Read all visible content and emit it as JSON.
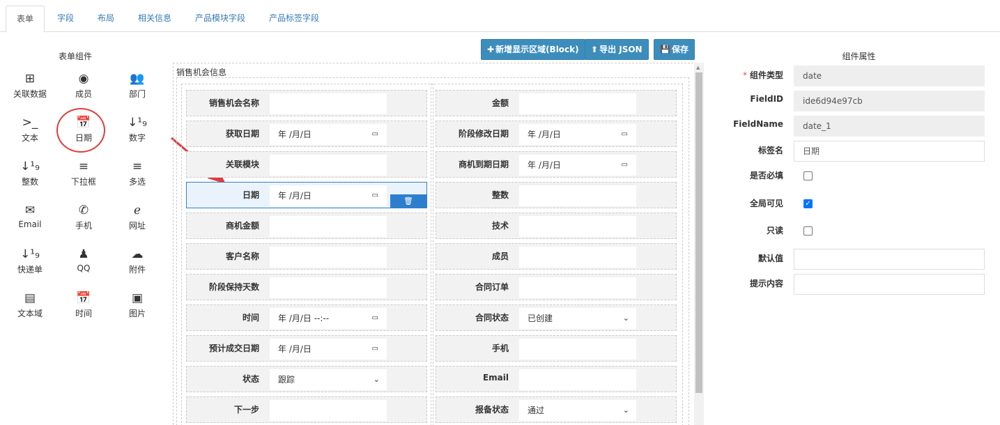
{
  "tabs": [
    {
      "label": "表单",
      "active": true
    },
    {
      "label": "字段"
    },
    {
      "label": "布局"
    },
    {
      "label": "相关信息"
    },
    {
      "label": "产品模块字段"
    },
    {
      "label": "产品标签字段"
    }
  ],
  "palette": {
    "title": "表单组件",
    "items": [
      {
        "label": "关联数据",
        "icon": "table-icon",
        "glyph": "⊞"
      },
      {
        "label": "成员",
        "icon": "user-circle-icon",
        "glyph": "◉"
      },
      {
        "label": "部门",
        "icon": "users-icon",
        "glyph": "👥"
      },
      {
        "label": "文本",
        "icon": "terminal-icon",
        "glyph": ">_"
      },
      {
        "label": "日期",
        "icon": "calendar-icon",
        "glyph": "📅"
      },
      {
        "label": "数字",
        "icon": "sort-numeric-icon",
        "glyph": "↓¹₉"
      },
      {
        "label": "整数",
        "icon": "sort-numeric-icon",
        "glyph": "↓¹₉"
      },
      {
        "label": "下拉框",
        "icon": "list-icon",
        "glyph": "≡"
      },
      {
        "label": "多选",
        "icon": "list-icon",
        "glyph": "≡"
      },
      {
        "label": "Email",
        "icon": "envelope-open-icon",
        "glyph": "✉"
      },
      {
        "label": "手机",
        "icon": "phone-icon",
        "glyph": "✆"
      },
      {
        "label": "网址",
        "icon": "ie-icon",
        "glyph": "ℯ"
      },
      {
        "label": "快递单",
        "icon": "sort-numeric-icon",
        "glyph": "↓¹₉"
      },
      {
        "label": "QQ",
        "icon": "qq-icon",
        "glyph": "♟"
      },
      {
        "label": "附件",
        "icon": "cloud-upload-icon",
        "glyph": "☁"
      },
      {
        "label": "文本域",
        "icon": "file-text-icon",
        "glyph": "▤"
      },
      {
        "label": "时间",
        "icon": "calendar-icon",
        "glyph": "📅"
      },
      {
        "label": "图片",
        "icon": "image-icon",
        "glyph": "▣"
      }
    ]
  },
  "toolbar": {
    "add_block_label": "新增显示区域(Block)",
    "export_label": "导出 JSON",
    "save_label": "保存"
  },
  "block": {
    "title": "销售机会信息",
    "left_fields": [
      {
        "label": "销售机会名称",
        "type": "text",
        "value": ""
      },
      {
        "label": "获取日期",
        "type": "date",
        "value": "年 /月/日"
      },
      {
        "label": "关联模块",
        "type": "text",
        "value": ""
      },
      {
        "label": "日期",
        "type": "date",
        "value": "年 /月/日",
        "selected": true
      },
      {
        "label": "商机金额",
        "type": "text",
        "value": ""
      },
      {
        "label": "客户名称",
        "type": "text",
        "value": ""
      },
      {
        "label": "阶段保持天数",
        "type": "text",
        "value": ""
      },
      {
        "label": "时间",
        "type": "datetime",
        "value": "年 /月/日  --:--"
      },
      {
        "label": "预计成交日期",
        "type": "date",
        "value": "年 /月/日"
      },
      {
        "label": "状态",
        "type": "select",
        "value": "跟踪"
      },
      {
        "label": "下一步",
        "type": "text",
        "value": ""
      }
    ],
    "right_fields": [
      {
        "label": "金额",
        "type": "text",
        "value": ""
      },
      {
        "label": "阶段修改日期",
        "type": "date",
        "value": "年 /月/日"
      },
      {
        "label": "商机到期日期",
        "type": "date",
        "value": "年 /月/日"
      },
      {
        "label": "整数",
        "type": "text",
        "value": ""
      },
      {
        "label": "技术",
        "type": "text",
        "value": ""
      },
      {
        "label": "成员",
        "type": "text",
        "value": ""
      },
      {
        "label": "合同订单",
        "type": "text",
        "value": ""
      },
      {
        "label": "合同状态",
        "type": "select",
        "value": "已创建"
      },
      {
        "label": "手机",
        "type": "text",
        "value": ""
      },
      {
        "label": "Email",
        "type": "text",
        "value": ""
      },
      {
        "label": "报备状态",
        "type": "select",
        "value": "通过"
      }
    ]
  },
  "properties": {
    "title": "组件属性",
    "component_type": {
      "label": "组件类型",
      "value": "date"
    },
    "field_id": {
      "label": "FieldID",
      "value": "ide6d94e97cb"
    },
    "field_name": {
      "label": "FieldName",
      "value": "date_1"
    },
    "tag_name": {
      "label": "标签名",
      "value": "日期"
    },
    "required": {
      "label": "是否必填",
      "checked": false
    },
    "globally_visible": {
      "label": "全局可见",
      "checked": true
    },
    "read_only": {
      "label": "只读",
      "checked": false
    },
    "default_value": {
      "label": "默认值",
      "value": ""
    },
    "hint": {
      "label": "提示内容",
      "value": ""
    }
  },
  "colors": {
    "accent": "#3c8dbc",
    "selection": "#2d7ecf",
    "annotation": "#e23b3b",
    "checkbox": "#0075ff"
  }
}
